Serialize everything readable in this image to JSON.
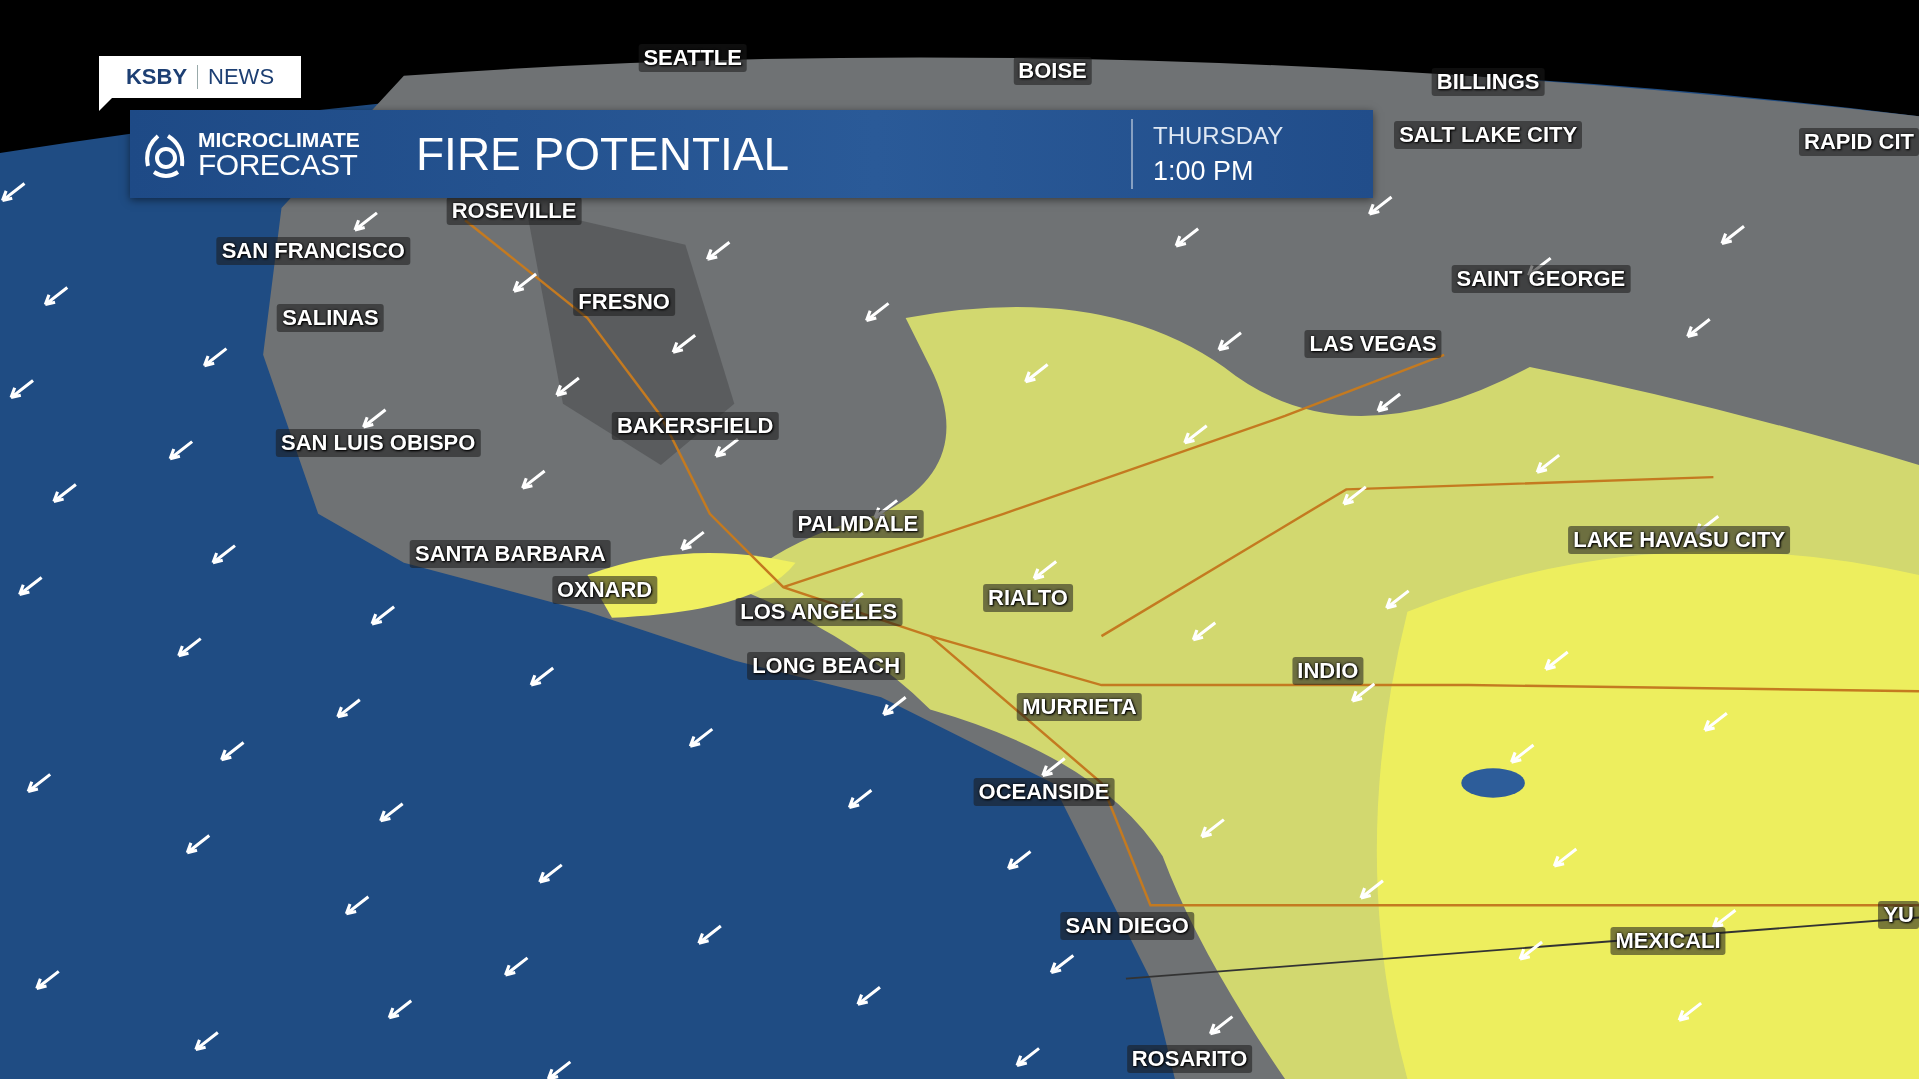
{
  "station_tag": {
    "call_sign": "KSBY",
    "section": "NEWS"
  },
  "banner": {
    "logo_top": "MICROCLIMATE",
    "logo_bottom": "FORECAST",
    "title": "FIRE POTENTIAL",
    "day": "THURSDAY",
    "time": "1:00 PM"
  },
  "cities": [
    "SEATTLE",
    "BOISE",
    "BILLINGS",
    "SALT LAKE CITY",
    "RAPID CIT",
    "ROSEVILLE",
    "SAN FRANCISCO",
    "FRESNO",
    "SALINAS",
    "SAINT GEORGE",
    "LAS VEGAS",
    "BAKERSFIELD",
    "SAN LUIS OBISPO",
    "PALMDALE",
    "LAKE HAVASU CITY",
    "SANTA BARBARA",
    "OXNARD",
    "RIALTO",
    "LOS ANGELES",
    "LONG BEACH",
    "INDIO",
    "MURRIETA",
    "OCEANSIDE",
    "SAN DIEGO",
    "MEXICALI",
    "YU",
    "ROSARITO"
  ]
}
